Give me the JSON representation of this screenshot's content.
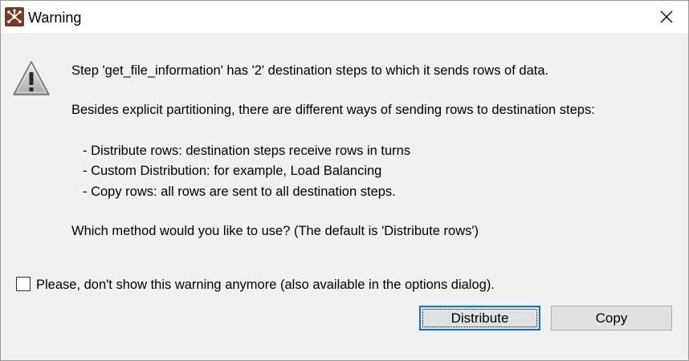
{
  "window": {
    "title": "Warning",
    "app_icon": "spoon-app-icon",
    "close_icon": "close-icon"
  },
  "message": {
    "icon": "warning-icon",
    "line1": "Step 'get_file_information' has '2' destination steps to which it sends rows of data.",
    "line2": "Besides explicit partitioning, there are different ways of sending rows to destination steps:",
    "bullets": [
      "- Distribute rows: destination steps receive rows in turns",
      "- Custom Distribution: for example,  Load Balancing",
      "- Copy rows: all rows are sent to all destination steps."
    ],
    "question": "Which method would you like to use? (The default is 'Distribute rows')"
  },
  "checkbox": {
    "checked": false,
    "label": "Please, don't show this warning anymore (also available in the options dialog)."
  },
  "buttons": {
    "distribute": "Distribute",
    "copy": "Copy"
  },
  "colors": {
    "dialog_bg": "#f0f0f0",
    "focus_border": "#0078d7",
    "app_icon_bg": "#7a3a2a"
  }
}
